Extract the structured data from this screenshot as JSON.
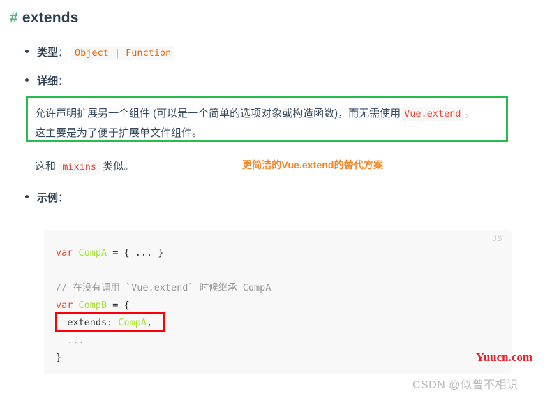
{
  "heading": {
    "hash": "#",
    "title": "extends"
  },
  "bullets": {
    "type": {
      "label": "类型",
      "colon": "：",
      "code": "Object | Function"
    },
    "detail": {
      "label": "详细",
      "colon": "："
    },
    "example": {
      "label": "示例",
      "colon": "："
    }
  },
  "green_box": {
    "line1_before": "允许声明扩展另一个组件 (可以是一个简单的选项对象或构造函数)，而无需使用",
    "line1_code": "Vue.extend",
    "line1_after": "。",
    "line2": "这主要是为了便于扩展单文件组件。",
    "border_color": "#26bd4d"
  },
  "note": {
    "before": "这和",
    "code": "mixins",
    "after": "类似。"
  },
  "annotation": {
    "text": "更简洁的Vue.extend的替代方案",
    "color": "#f5872b"
  },
  "code_block": {
    "lang": "JS",
    "lines": [
      {
        "tokens": [
          {
            "t": "var ",
            "c": "tok-kw"
          },
          {
            "t": "CompA",
            "c": "tok-var"
          },
          {
            "t": " = { ... }",
            "c": "tok-pun"
          }
        ]
      },
      {
        "tokens": [
          {
            "t": "",
            "c": "tok-pun"
          }
        ]
      },
      {
        "tokens": [
          {
            "t": "// 在没有调用 `Vue.extend` 时候继承 CompA",
            "c": "tok-com"
          }
        ]
      },
      {
        "tokens": [
          {
            "t": "var ",
            "c": "tok-kw"
          },
          {
            "t": "CompB",
            "c": "tok-var"
          },
          {
            "t": " = {",
            "c": "tok-pun"
          }
        ]
      },
      {
        "tokens": [
          {
            "t": "  extends: ",
            "c": "tok-prop"
          },
          {
            "t": "CompA",
            "c": "tok-var"
          },
          {
            "t": ",",
            "c": "tok-pun"
          }
        ]
      },
      {
        "tokens": [
          {
            "t": "  ...",
            "c": "tok-com"
          }
        ]
      },
      {
        "tokens": [
          {
            "t": "}",
            "c": "tok-pun"
          }
        ]
      }
    ],
    "highlight_border_color": "#fb0007"
  },
  "watermarks": {
    "yuucn": "Yuucn.com",
    "csdn": "CSDN @似曾不相识"
  }
}
